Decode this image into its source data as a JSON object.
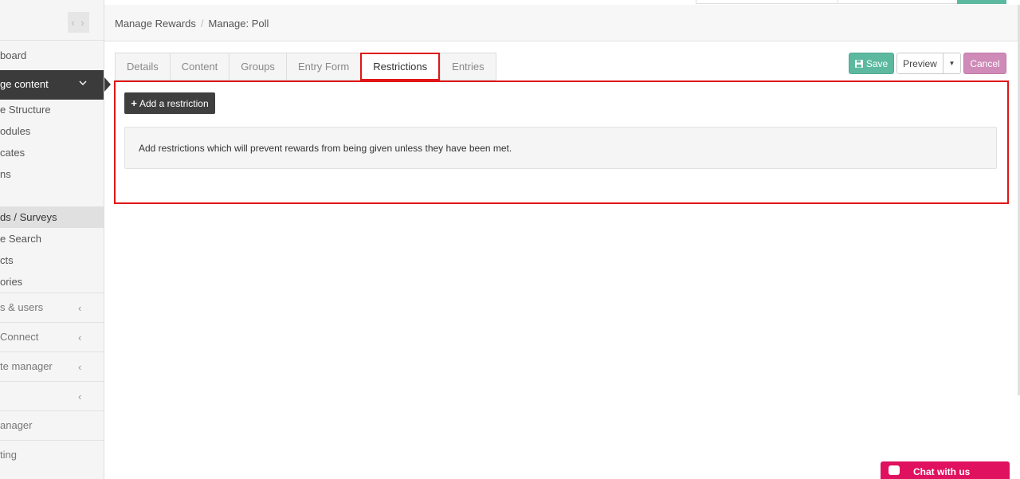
{
  "sidebar": {
    "toggle_icon": "chevron-left-right-icon",
    "items": [
      {
        "label": "board"
      },
      {
        "label": "ge content"
      },
      {
        "label": "e Structure"
      },
      {
        "label": "odules"
      },
      {
        "label": "cates"
      },
      {
        "label": "ns"
      },
      {
        "label": "ds / Surveys"
      },
      {
        "label": "e Search"
      },
      {
        "label": "cts"
      },
      {
        "label": "ories"
      },
      {
        "label": "s & users"
      },
      {
        "label": " Connect"
      },
      {
        "label": "te manager"
      },
      {
        "label": ""
      },
      {
        "label": "anager"
      },
      {
        "label": "ting"
      }
    ]
  },
  "breadcrumb": {
    "items": [
      "Manage Rewards",
      "Manage: Poll"
    ],
    "separator": "/"
  },
  "tabs": [
    {
      "label": "Details"
    },
    {
      "label": "Content"
    },
    {
      "label": "Groups"
    },
    {
      "label": "Entry Form"
    },
    {
      "label": "Restrictions",
      "active": true
    },
    {
      "label": "Entries"
    }
  ],
  "actions": {
    "save": "Save",
    "preview": "Preview",
    "cancel": "Cancel"
  },
  "restrictions": {
    "add_button": "Add a restriction",
    "info_text": "Add restrictions which will prevent rewards from being given unless they have been met."
  },
  "chat": {
    "label": "Chat with us"
  },
  "colors": {
    "accent_green": "#5cb99f",
    "cancel_pink": "#cf8ab8",
    "highlight_red": "#e01616",
    "chat_pink": "#e0115f",
    "sidebar_active": "#3b3b3b"
  }
}
